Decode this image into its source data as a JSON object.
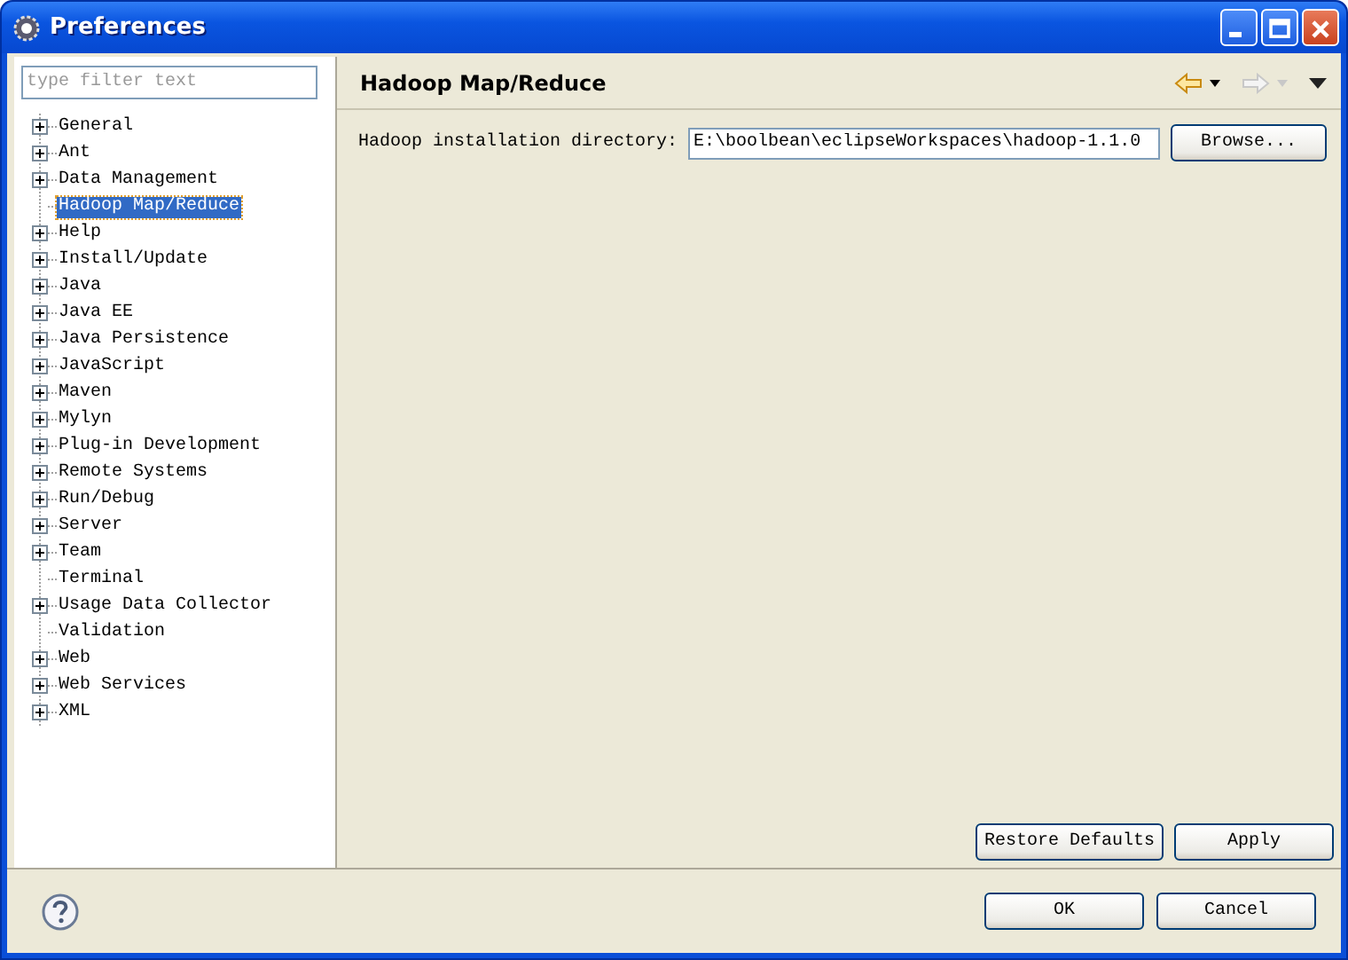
{
  "window": {
    "title": "Preferences"
  },
  "filter": {
    "placeholder": "type filter text"
  },
  "tree": [
    {
      "label": "General",
      "expandable": true,
      "selected": false
    },
    {
      "label": "Ant",
      "expandable": true,
      "selected": false
    },
    {
      "label": "Data Management",
      "expandable": true,
      "selected": false
    },
    {
      "label": "Hadoop Map/Reduce",
      "expandable": false,
      "selected": true
    },
    {
      "label": "Help",
      "expandable": true,
      "selected": false
    },
    {
      "label": "Install/Update",
      "expandable": true,
      "selected": false
    },
    {
      "label": "Java",
      "expandable": true,
      "selected": false
    },
    {
      "label": "Java EE",
      "expandable": true,
      "selected": false
    },
    {
      "label": "Java Persistence",
      "expandable": true,
      "selected": false
    },
    {
      "label": "JavaScript",
      "expandable": true,
      "selected": false
    },
    {
      "label": "Maven",
      "expandable": true,
      "selected": false
    },
    {
      "label": "Mylyn",
      "expandable": true,
      "selected": false
    },
    {
      "label": "Plug-in Development",
      "expandable": true,
      "selected": false
    },
    {
      "label": "Remote Systems",
      "expandable": true,
      "selected": false
    },
    {
      "label": "Run/Debug",
      "expandable": true,
      "selected": false
    },
    {
      "label": "Server",
      "expandable": true,
      "selected": false
    },
    {
      "label": "Team",
      "expandable": true,
      "selected": false
    },
    {
      "label": "Terminal",
      "expandable": false,
      "selected": false
    },
    {
      "label": "Usage Data Collector",
      "expandable": true,
      "selected": false
    },
    {
      "label": "Validation",
      "expandable": false,
      "selected": false
    },
    {
      "label": "Web",
      "expandable": true,
      "selected": false
    },
    {
      "label": "Web Services",
      "expandable": true,
      "selected": false
    },
    {
      "label": "XML",
      "expandable": true,
      "selected": false
    }
  ],
  "page": {
    "title": "Hadoop Map/Reduce",
    "field": {
      "label": "Hadoop installation directory:",
      "value": "E:\\boolbean\\eclipseWorkspaces\\hadoop-1.1.0"
    },
    "browse_button": "Browse...",
    "buttons": [
      "Restore Defaults",
      "Apply"
    ]
  },
  "dialog_buttons": [
    "OK",
    "Cancel"
  ]
}
